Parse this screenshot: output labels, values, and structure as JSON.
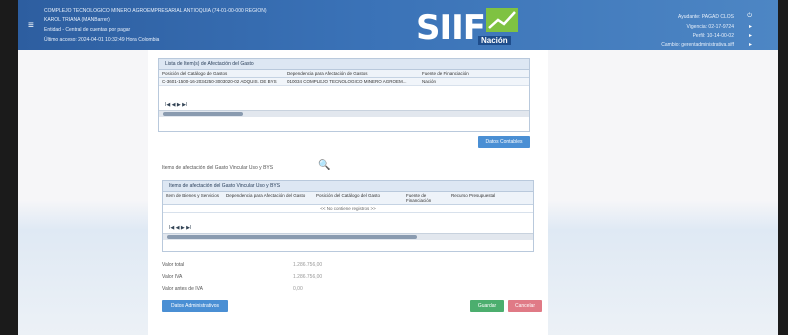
{
  "header": {
    "line1": "COMPLEJO TECNOLOGICO MINERO AGROEMPRESARIAL ANTIOQUIA (74-01-00-000 REGION)",
    "line2": "KAROL TRIANA (MANBarrer)",
    "line3": "Entidad - Central de cuentas por pagar",
    "line4": "Último acceso: 2024-04-01 10:32:49 Hora Colombia",
    "logo_text": "SIIF",
    "logo_sub": "Nación",
    "right1": "Ayudante: PAGAD CLOS",
    "right2": "Vigencia: 02-17-9724",
    "right3": "Perfil: 10-14-00-02",
    "right4": "Cambio: gerentadministrativa.siff"
  },
  "panel1": {
    "title": "Lista de Item(s) de Afectación del Gasto",
    "columns": [
      "Posición del Catálogo de Gastos",
      "Dependencia para Afectación de Gastos",
      "Fuente de Financiación"
    ],
    "rows": [
      [
        "C-3601-1500-16-2034250-3003020-02 ADQUIS. DE BYS",
        "010034 COMPLEJO TECNOLOGICO MINERO AGROEM...",
        "Nación"
      ]
    ],
    "pager": "I◀ ◀ ▶ ▶I"
  },
  "btn_datos_contables": "Datos Contables",
  "search_label": "Items de afectación del Gasto Vincular Uso y BYS",
  "panel2": {
    "title": "Items de afectación del Gasto Vincular Uso y BYS",
    "columns": [
      "Item de Bienes y Servicios",
      "Dependencia para Afectación del Gasto",
      "Posición del Catálogo del Gasto",
      "Fuente de Financiación",
      "Recurso Presupuestal"
    ],
    "empty_message": "<< No contiene registros >>",
    "pager": "I◀ ◀ ▶ ▶I"
  },
  "summary": {
    "valor_total_label": "Valor total",
    "valor_total": "1.286.756,00",
    "valor_iva_label": "Valor IVA",
    "valor_iva": "1.286.756,00",
    "valor_antes_label": "Valor antes de IVA",
    "valor_antes": "0,00"
  },
  "buttons": {
    "datos_admin": "Datos Administrativos",
    "guardar": "Guardar",
    "cancelar": "Cancelar"
  }
}
